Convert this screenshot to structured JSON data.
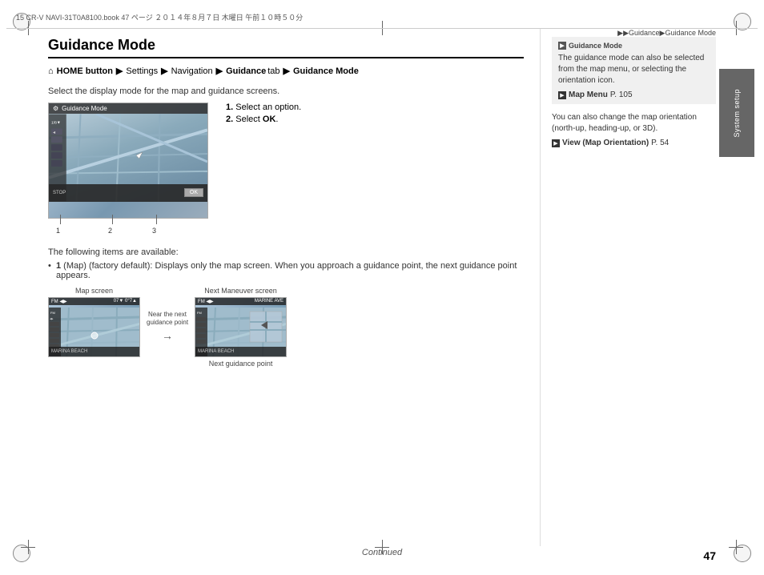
{
  "page": {
    "number": "47",
    "continued_label": "Continued"
  },
  "header": {
    "file_info": "15 CR-V NAVI-31T0A8100.book   47 ページ   ２０１４年８月７日   木曜日   午前１０時５０分",
    "breadcrumb": "▶▶Guidance▶Guidance Mode"
  },
  "title": "Guidance Mode",
  "nav_path": {
    "home_symbol": "⌂",
    "home_label": "HOME button",
    "arrow1": "▶",
    "settings": "Settings",
    "arrow2": "▶",
    "navigation": "Navigation",
    "arrow3": "▶",
    "guidance": "Guidance",
    "tab_label": "tab",
    "arrow4": "▶",
    "mode_label": "Guidance Mode"
  },
  "description": "Select the display mode for the map and guidance screens.",
  "steps": [
    {
      "num": "1.",
      "text": "Select an option."
    },
    {
      "num": "2.",
      "text": "Select OK."
    }
  ],
  "callouts": [
    "1",
    "2",
    "3"
  ],
  "available_text": "The following items are available:",
  "bullet_items": [
    {
      "number": "1",
      "label": " (Map) (factory default): Displays only the map screen. When you approach a guidance point, the next guidance point appears."
    }
  ],
  "map_screens": {
    "map_label": "Map screen",
    "near_label": "Near the next\nguidance point",
    "arrow_symbol": "→",
    "next_maneuver_label": "Next Maneuver screen",
    "next_guidance_label": "Next guidance point"
  },
  "screenshot": {
    "title": "Guidance Mode"
  },
  "right_column": {
    "note_header": "Guidance Mode",
    "note_text1": "The guidance mode can also be selected from the map menu, or selecting the orientation icon.",
    "note_link1_icon": "▶",
    "note_link1_text": "Map Menu",
    "note_link1_page": "P. 105",
    "note_text2": "You can also change the map orientation (north-up, heading-up, or 3D).",
    "note_link2_icon": "▶",
    "note_link2_text": "View (Map Orientation)",
    "note_link2_page": "P. 54"
  },
  "sidebar_tab": "System setup"
}
